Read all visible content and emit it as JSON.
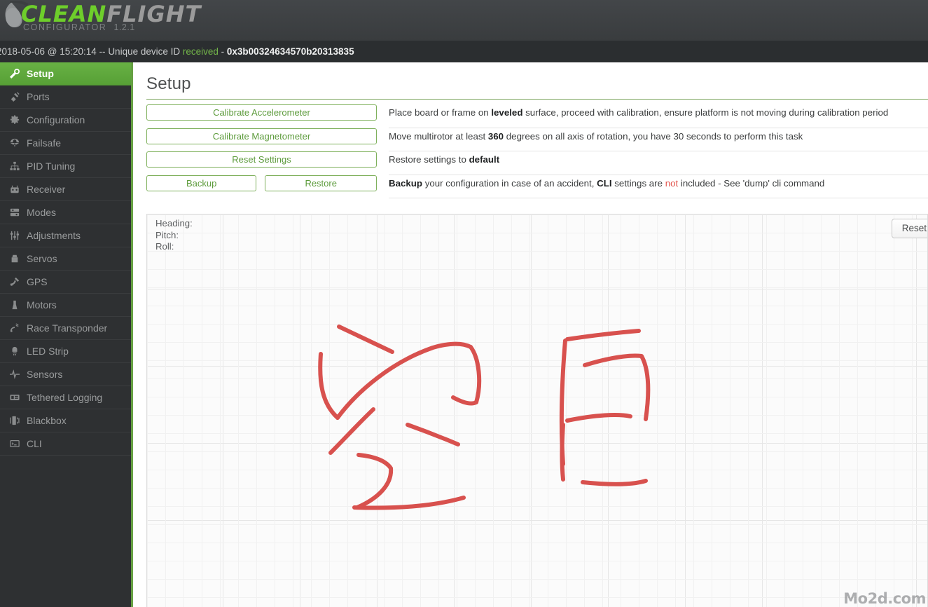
{
  "header": {
    "logo_primary": "CLEAN",
    "logo_secondary": "FLIGHT",
    "subtitle": "CONFIGURATOR",
    "version": "1.2.1",
    "logo_icon": "propeller-drop-icon"
  },
  "status": {
    "timestamp": "2018-05-06 @ 15:20:14",
    "separator": " -- ",
    "message": "Unique device ID ",
    "state": "received",
    "dash": " - ",
    "device_id": "0x3b00324634570b20313835",
    "state_color": "#74b74a"
  },
  "sidebar": {
    "active_index": 0,
    "accent_color": "#5fa83d",
    "items": [
      {
        "label": "Setup",
        "icon": "wrench-icon"
      },
      {
        "label": "Ports",
        "icon": "plug-icon"
      },
      {
        "label": "Configuration",
        "icon": "gear-icon"
      },
      {
        "label": "Failsafe",
        "icon": "parachute-icon"
      },
      {
        "label": "PID Tuning",
        "icon": "sitemap-icon"
      },
      {
        "label": "Receiver",
        "icon": "transmitter-icon"
      },
      {
        "label": "Modes",
        "icon": "sliders-stack-icon"
      },
      {
        "label": "Adjustments",
        "icon": "faders-icon"
      },
      {
        "label": "Servos",
        "icon": "servo-icon"
      },
      {
        "label": "GPS",
        "icon": "satellite-icon"
      },
      {
        "label": "Motors",
        "icon": "motor-icon"
      },
      {
        "label": "Race Transponder",
        "icon": "signal-icon"
      },
      {
        "label": "LED Strip",
        "icon": "led-icon"
      },
      {
        "label": "Sensors",
        "icon": "waveform-icon"
      },
      {
        "label": "Tethered Logging",
        "icon": "log-icon"
      },
      {
        "label": "Blackbox",
        "icon": "blackbox-icon"
      },
      {
        "label": "CLI",
        "icon": "terminal-icon"
      }
    ]
  },
  "main": {
    "title": "Setup",
    "rows": [
      {
        "buttons": [
          {
            "label": "Calibrate Accelerometer"
          }
        ],
        "desc_html": "Place board or frame on <b>leveled</b> surface, proceed with calibration, ensure platform is not moving during calibration period"
      },
      {
        "buttons": [
          {
            "label": "Calibrate Magnetometer"
          }
        ],
        "desc_html": "Move multirotor at least <b>360</b> degrees on all axis of rotation, you have 30 seconds to perform this task"
      },
      {
        "buttons": [
          {
            "label": "Reset Settings"
          }
        ],
        "desc_html": "Restore settings to <b>default</b>"
      },
      {
        "buttons": [
          {
            "label": "Backup"
          },
          {
            "label": "Restore"
          }
        ],
        "desc_html": "<b>Backup</b> your configuration in case of an accident, <b>CLI</b> settings are <span class=\"red\">not</span> included - See 'dump' cli command"
      }
    ]
  },
  "model_panel": {
    "attitude_labels": [
      "Heading:",
      "Pitch:",
      "Roll:"
    ],
    "heading_value": "",
    "pitch_value": "",
    "roll_value": "",
    "reset_label": "Reset",
    "watermark": "Mo2d.com",
    "annotation_color": "#d8514e",
    "annotation_note": "hand-drawn red ink marks over the 3D model area"
  }
}
